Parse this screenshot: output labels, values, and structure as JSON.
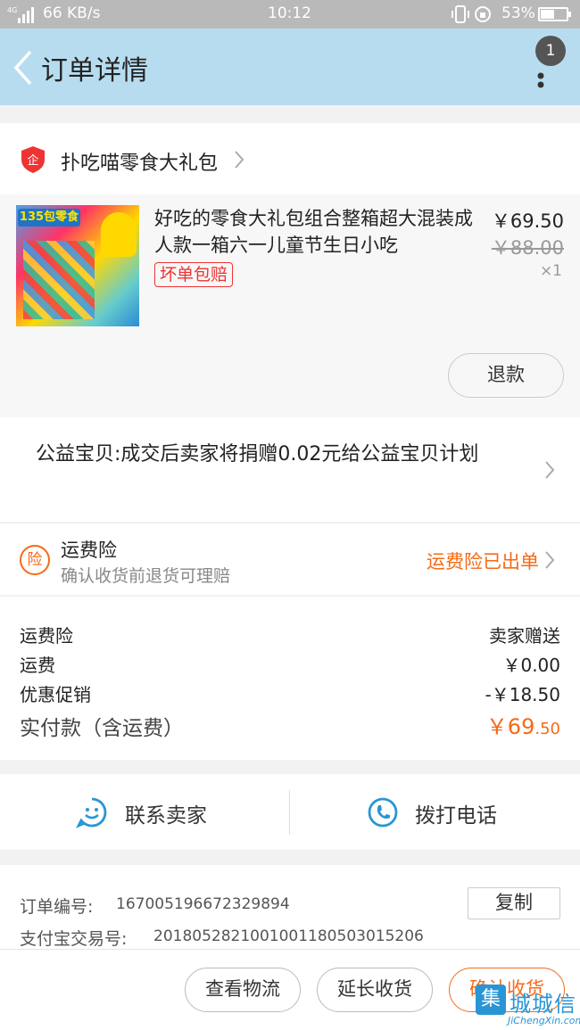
{
  "status_bar": {
    "network": "4G",
    "speed": "66 KB/s",
    "time": "10:12",
    "battery": "53%",
    "battery_level": 0.53
  },
  "app_bar": {
    "title": "订单详情",
    "badge_count": "1"
  },
  "shop": {
    "name": "扑吃喵零食大礼包",
    "icon_text": "企"
  },
  "product": {
    "title": "好吃的零食大礼包组合整箱超大混装成人款一箱六一儿童节生日小吃",
    "price_now": "￥69.50",
    "price_original": "￥88.00",
    "quantity": "×1",
    "guarantee_tag": "坏单包赔",
    "refund_label": "退款",
    "thumb_text": "135包零食"
  },
  "charity": {
    "text": "公益宝贝:成交后卖家将捐赠0.02元给公益宝贝计划"
  },
  "insurance": {
    "icon_text": "险",
    "title": "运费险",
    "subtitle": "确认收货前退货可理赔",
    "status": "运费险已出单"
  },
  "fees": {
    "rows": [
      {
        "label": "运费险",
        "value": "卖家赠送"
      },
      {
        "label": "运费",
        "value": "￥0.00"
      },
      {
        "label": "优惠促销",
        "value": "-￥18.50"
      }
    ],
    "total_label": "实付款（含运费）",
    "total_main": "￥69",
    "total_decimal": ".50"
  },
  "contact": {
    "seller_label": "联系卖家",
    "phone_label": "拨打电话"
  },
  "order_info": {
    "order_no_label": "订单编号:",
    "order_no": "167005196672329894",
    "alipay_label": "支付宝交易号:",
    "alipay_no": "2018052821001001180503015206",
    "copy_label": "复制"
  },
  "actions": {
    "logistics": "查看物流",
    "extend": "延长收货",
    "confirm": "确认收货"
  },
  "watermark": {
    "box": "集",
    "text": "城城信",
    "sub": "JiChengXin.com"
  },
  "colors": {
    "app_bar": "#b8dcef",
    "accent": "#f56a16",
    "alert_red": "#e33333",
    "link_blue": "#2a95d4"
  }
}
